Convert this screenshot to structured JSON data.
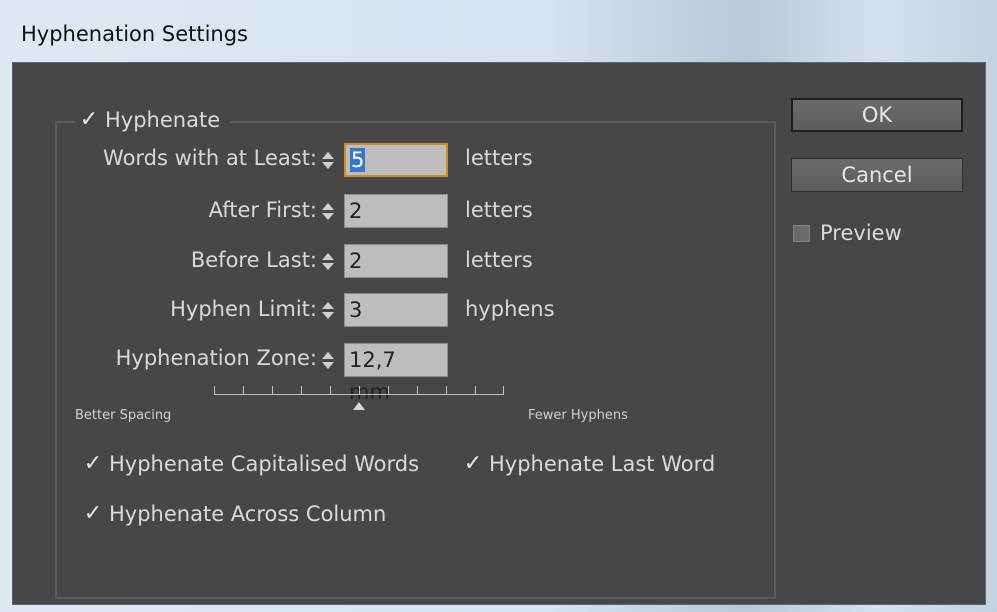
{
  "window": {
    "title": "Hyphenation Settings"
  },
  "hyphenate": {
    "label": "Hyphenate",
    "checked": true
  },
  "fields": [
    {
      "label": "Words with at Least:",
      "value": "5",
      "unit": "letters",
      "focused": true
    },
    {
      "label": "After First:",
      "value": "2",
      "unit": "letters"
    },
    {
      "label": "Before Last:",
      "value": "2",
      "unit": "letters"
    },
    {
      "label": "Hyphen Limit:",
      "value": "3",
      "unit": "hyphens"
    },
    {
      "label": "Hyphenation Zone:",
      "value": "12,7 mm",
      "unit": ""
    }
  ],
  "slider": {
    "left_label": "Better Spacing",
    "right_label": "Fewer Hyphens",
    "position": 0.5
  },
  "options": {
    "capitalised": {
      "label": "Hyphenate Capitalised Words",
      "checked": true
    },
    "last_word": {
      "label": "Hyphenate Last Word",
      "checked": true
    },
    "across_column": {
      "label": "Hyphenate Across Column",
      "checked": true
    }
  },
  "buttons": {
    "ok": "OK",
    "cancel": "Cancel"
  },
  "preview": {
    "label": "Preview",
    "checked": false
  },
  "icons": {
    "checkmark": "checkmark-icon",
    "spinner": "spinner-arrows-icon",
    "slider_thumb": "triangle-up-icon"
  }
}
